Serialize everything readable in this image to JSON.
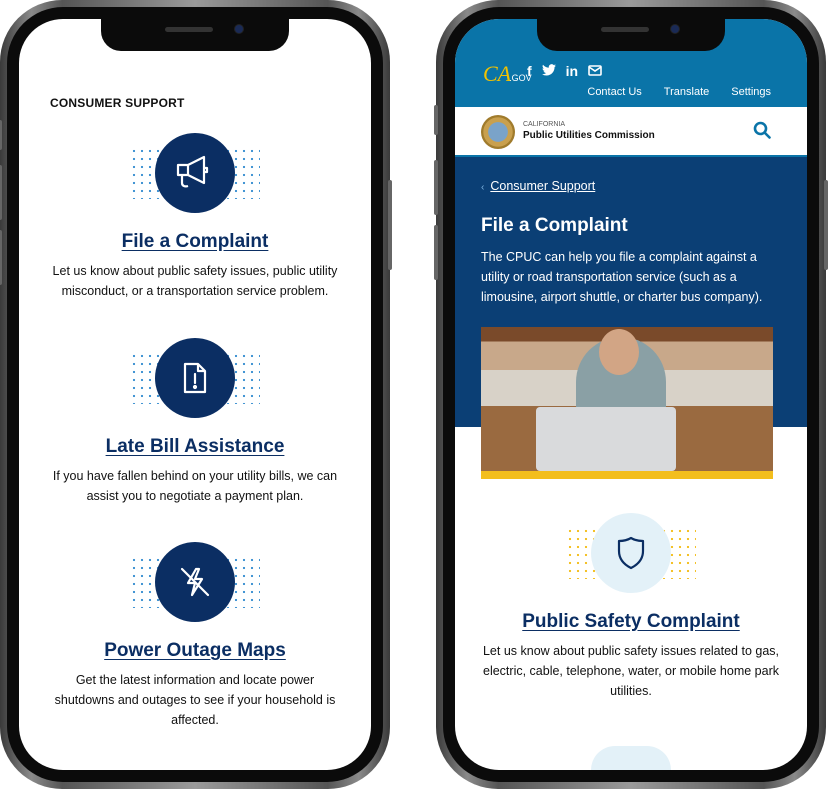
{
  "left_phone": {
    "section_heading": "CONSUMER SUPPORT",
    "cards": [
      {
        "icon": "megaphone-icon",
        "title": "File a Complaint",
        "description": "Let us know about public safety issues, public utility misconduct, or a transportation service problem."
      },
      {
        "icon": "document-alert-icon",
        "title": "Late Bill Assistance",
        "description": "If you have fallen behind on your utility bills, we can assist you to negotiate a payment plan."
      },
      {
        "icon": "power-off-icon",
        "title": "Power Outage Maps",
        "description": "Get the latest information and locate power shutdowns and outages to see if your household is affected."
      }
    ]
  },
  "right_phone": {
    "top_bar": {
      "logo": "CA",
      "logo_suffix": ".GOV",
      "social": [
        "f",
        "t",
        "in",
        "mail"
      ],
      "links": [
        "Contact Us",
        "Translate",
        "Settings"
      ]
    },
    "header": {
      "org_top": "CALIFORNIA",
      "org_name": "Public Utilities Commission"
    },
    "breadcrumb": "Consumer Support",
    "page_title": "File a Complaint",
    "intro": "The CPUC can help you file a complaint against a utility or road transportation service (such as a limousine, airport shuttle, or charter bus company).",
    "card": {
      "icon": "shield-icon",
      "title": "Public Safety Complaint",
      "description": "Let us know about public safety issues related to gas, electric, cable, telephone, water, or mobile home park utilities."
    }
  },
  "colors": {
    "navy": "#0b2e63",
    "top_blue": "#0a74a8",
    "hero_blue": "#0b3f75",
    "gold": "#f3be1d"
  }
}
